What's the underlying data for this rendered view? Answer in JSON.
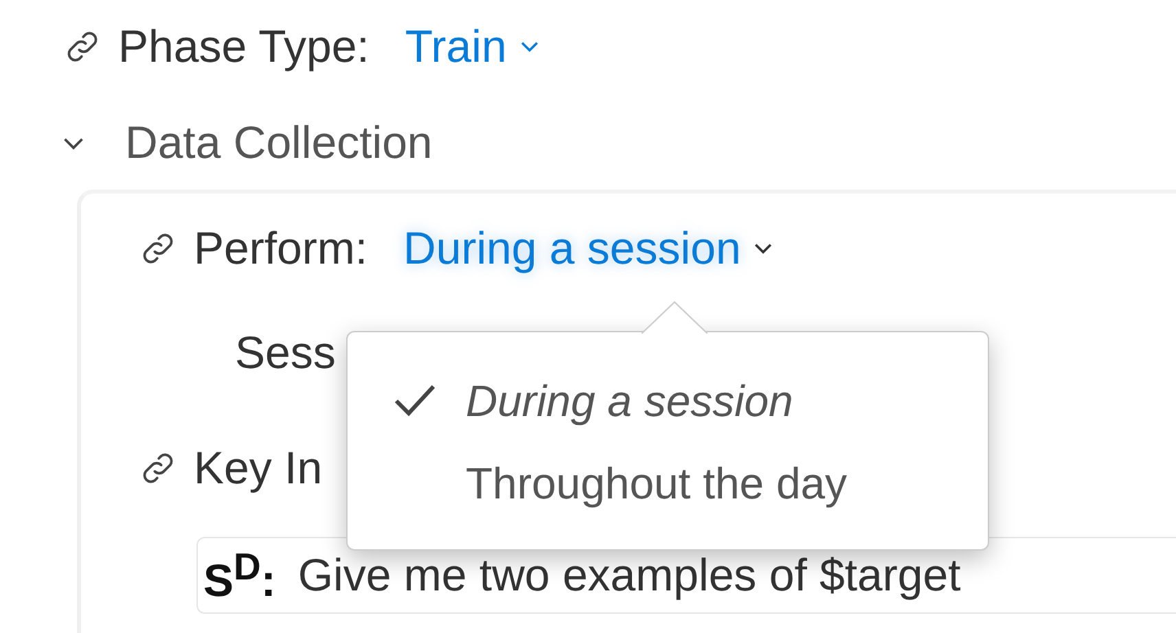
{
  "phase_type": {
    "label": "Phase Type:",
    "value": "Train"
  },
  "section": {
    "title": "Data Collection",
    "expanded": true
  },
  "perform": {
    "label": "Perform:",
    "value": "During a session"
  },
  "session_label": "Sess",
  "key_instruction": {
    "label": "Key In",
    "sd_label": "S$^{D}$:",
    "value": "Give me two examples of $target"
  },
  "dropdown": {
    "options": [
      {
        "label": "During a session",
        "selected": true
      },
      {
        "label": "Throughout the day",
        "selected": false
      }
    ]
  }
}
